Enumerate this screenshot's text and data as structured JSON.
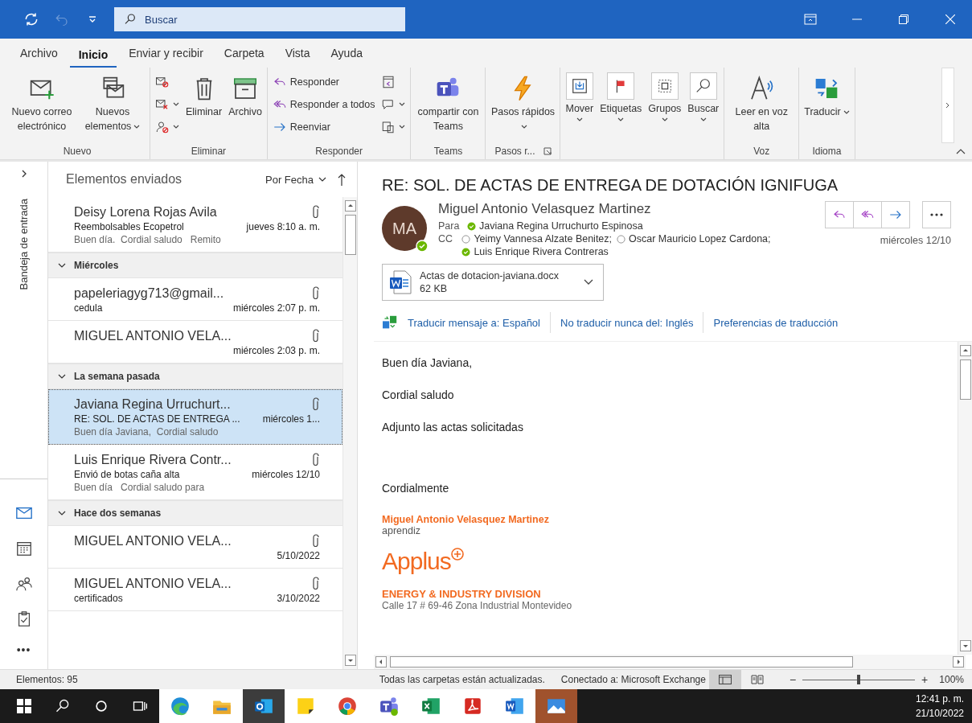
{
  "title_bar": {
    "search_placeholder": "Buscar",
    "undo_disabled": true
  },
  "menu_tabs": [
    {
      "label": "Archivo",
      "selected": false
    },
    {
      "label": "Inicio",
      "selected": true
    },
    {
      "label": "Enviar y recibir",
      "selected": false
    },
    {
      "label": "Carpeta",
      "selected": false
    },
    {
      "label": "Vista",
      "selected": false
    },
    {
      "label": "Ayuda",
      "selected": false
    }
  ],
  "ribbon": {
    "groups": [
      {
        "label": "Nuevo",
        "items": [
          {
            "kind": "large",
            "label": "Nuevo correo electrónico",
            "menu": false
          },
          {
            "kind": "large",
            "label": "Nuevos elementos",
            "menu": true
          }
        ]
      },
      {
        "label": "Eliminar",
        "items": [
          {
            "kind": "stack",
            "buttons": [
              {
                "menu": false
              },
              {
                "menu": true
              },
              {
                "menu": true
              }
            ]
          },
          {
            "kind": "large",
            "label": "Eliminar",
            "menu": false
          },
          {
            "kind": "large",
            "label": "Archivo",
            "menu": false
          }
        ]
      },
      {
        "label": "Responder",
        "items": [
          {
            "kind": "stack",
            "buttons": [
              {
                "label": "Responder",
                "menu": false
              },
              {
                "label": "Responder a todos",
                "menu": false
              },
              {
                "label": "Reenviar",
                "menu": false
              }
            ]
          },
          {
            "kind": "stack",
            "buttons": [
              {
                "menu": false
              },
              {
                "menu": true
              },
              {
                "menu": true
              }
            ]
          }
        ]
      },
      {
        "label": "Teams",
        "items": [
          {
            "kind": "large",
            "label": "compartir con Teams",
            "menu": false
          }
        ]
      },
      {
        "label": "Pasos r...",
        "launcher": true,
        "items": [
          {
            "kind": "large",
            "label": "Pasos rápidos",
            "menu": true
          }
        ]
      },
      {
        "items": [
          {
            "kind": "boxed",
            "label": "Mover",
            "menu": true
          },
          {
            "kind": "boxed",
            "label": "Etiquetas",
            "menu": true
          },
          {
            "kind": "boxed",
            "label": "Grupos",
            "menu": true
          },
          {
            "kind": "boxed",
            "label": "Buscar",
            "menu": true
          }
        ]
      },
      {
        "label": "Voz",
        "items": [
          {
            "kind": "large",
            "label": "Leer en voz alta",
            "menu": false
          }
        ]
      },
      {
        "label": "Idioma",
        "items": [
          {
            "kind": "large",
            "label": "Traducir",
            "menu": true
          }
        ]
      }
    ]
  },
  "nav": {
    "folder": "Bandeja de entrada",
    "items": [
      {
        "selected": true
      },
      {
        "selected": false
      },
      {
        "selected": false
      },
      {
        "selected": false
      }
    ],
    "more": "•••"
  },
  "message_list": {
    "folder": "Elementos enviados",
    "sort": "Por Fecha",
    "items": [
      {
        "kind": "message",
        "sender": "Deisy Lorena Rojas Avila",
        "subject": "Reembolsables Ecopetrol",
        "time": "jueves 8:10 a. m.",
        "preview": "Buen día.  Cordial saludo   Remito",
        "attachment": true,
        "selected": false
      },
      {
        "kind": "header",
        "label": "Miércoles",
        "expanded": true
      },
      {
        "kind": "message",
        "sender": "papeleriagyg713@gmail...",
        "subject": "cedula",
        "time": "miércoles 2:07 p. m.",
        "attachment": true,
        "selected": false
      },
      {
        "kind": "message",
        "sender": "MIGUEL ANTONIO VELA...",
        "time": "miércoles 2:03 p. m.",
        "attachment": true,
        "selected": false
      },
      {
        "kind": "header",
        "label": "La semana pasada",
        "expanded": true
      },
      {
        "kind": "message",
        "sender": "Javiana Regina Urruchurt...",
        "subject": "RE: SOL. DE ACTAS DE ENTREGA ...",
        "time": "miércoles 1...",
        "preview": "Buen día Javiana,  Cordial saludo",
        "attachment": true,
        "selected": true
      },
      {
        "kind": "message",
        "sender": "Luis Enrique Rivera Contr...",
        "subject": "Envió de botas caña alta",
        "time": "miércoles 12/10",
        "preview": "Buen día   Cordial saludo para",
        "attachment": true,
        "selected": false
      },
      {
        "kind": "header",
        "label": "Hace dos semanas",
        "expanded": true
      },
      {
        "kind": "message",
        "sender": "MIGUEL ANTONIO VELA...",
        "time": "5/10/2022",
        "attachment": true,
        "selected": false
      },
      {
        "kind": "message",
        "sender": "MIGUEL ANTONIO VELA...",
        "subject": "certificados",
        "time": "3/10/2022",
        "attachment": true,
        "selected": false
      }
    ]
  },
  "reading_pane": {
    "subject": "RE: SOL. DE ACTAS DE ENTREGA DE DOTACIÓN IGNIFUGA",
    "sender": "Miguel Antonio Velasquez Martinez",
    "initials": "MA",
    "sender_online": true,
    "date": "miércoles 12/10",
    "to_label": "Para",
    "to": [
      {
        "name": "Javiana Regina Urruchurto Espinosa",
        "online": true
      }
    ],
    "cc_label": "CC",
    "cc": [
      {
        "name": "Yeimy Vannesa Alzate Benitez;",
        "online": false
      },
      {
        "name": "Oscar Mauricio Lopez Cardona;",
        "online": false
      },
      {
        "name": "Luis Enrique Rivera Contreras",
        "online": true
      }
    ],
    "attachment": {
      "name": "Actas de dotacion-javiana.docx",
      "size": "62 KB"
    },
    "translate_links": [
      "Traducir mensaje a: Español",
      "No traducir nunca del: Inglés",
      "Preferencias de traducción"
    ],
    "body": [
      "Buen día Javiana,",
      "Cordial saludo",
      "Adjunto las actas solicitadas",
      "Cordialmente"
    ],
    "signature": {
      "name": "Miguel Antonio Velasquez Martinez",
      "role": "aprendiz",
      "logo": "Applus",
      "division": "ENERGY & INDUSTRY DIVISION",
      "address": "Calle 17 # 69-46 Zona Industrial Montevideo"
    }
  },
  "status_bar": {
    "items_count": "Elementos: 95",
    "sync": "Todas las carpetas están actualizadas.",
    "connection": "Conectado a: Microsoft Exchange",
    "zoom_out": "−",
    "zoom_in": "+",
    "level": 0.5,
    "zoom": "100%"
  },
  "taskbar": {
    "apps": [
      {
        "selected": false
      },
      {
        "selected": false
      },
      {
        "selected": true
      },
      {
        "selected": false
      },
      {
        "selected": false
      },
      {
        "selected": false
      },
      {
        "selected": false
      },
      {
        "selected": false
      },
      {
        "selected": false
      },
      {
        "selected": true
      }
    ],
    "time": "12:41 p. m.",
    "date": "21/10/2022"
  }
}
